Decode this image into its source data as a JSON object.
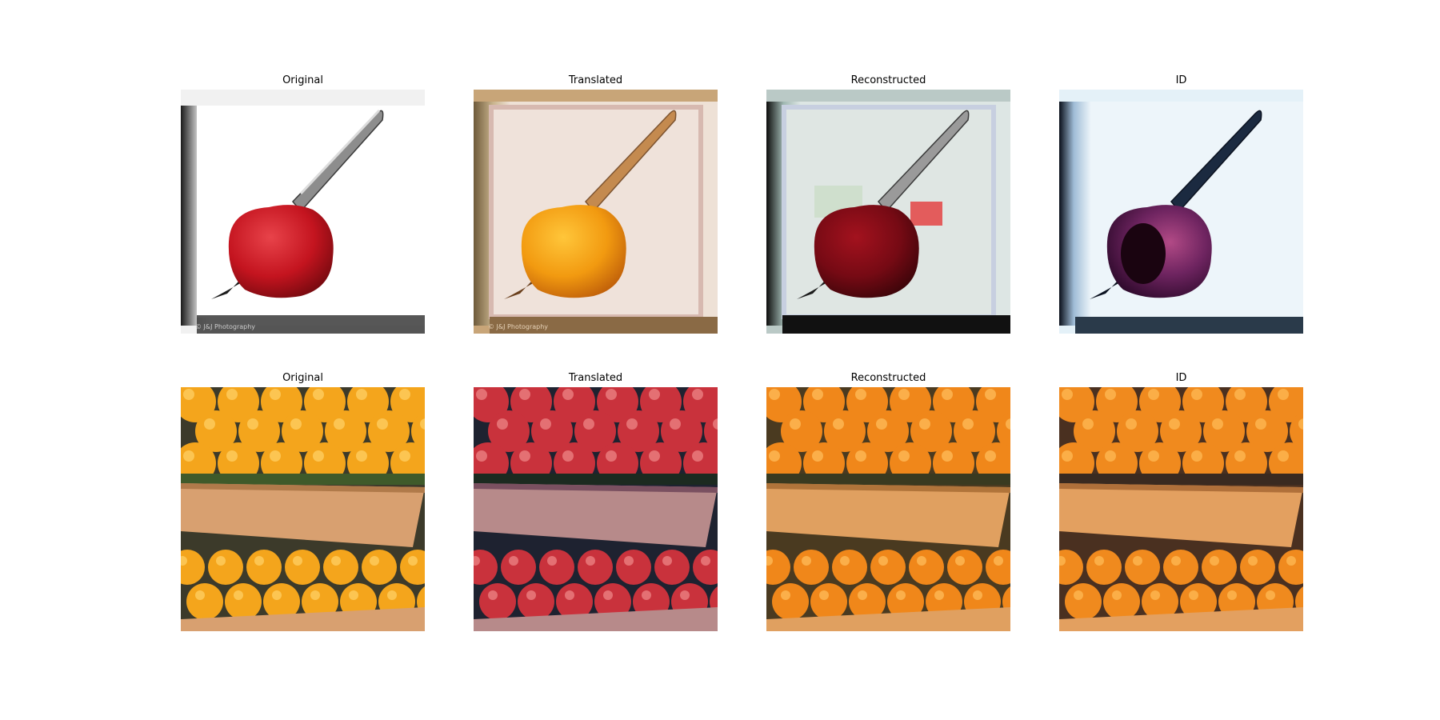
{
  "figure": {
    "rows": [
      {
        "subject": "apple with knife",
        "panels": [
          {
            "title": "Original",
            "image": "photo of red apple pierced by a silver knife on white background"
          },
          {
            "title": "Translated",
            "image": "same scene translated with the apple turned orange"
          },
          {
            "title": "Reconstructed",
            "image": "reconstruction of the apple scene, dark red apple"
          },
          {
            "title": "ID",
            "image": "identity mapping of the apple scene, purple apple on pale blue background"
          }
        ]
      },
      {
        "subject": "crates of oranges",
        "panels": [
          {
            "title": "Original",
            "image": "photo of oranges stacked in cardboard crates"
          },
          {
            "title": "Translated",
            "image": "same crates translated with oranges turned into red apples"
          },
          {
            "title": "Reconstructed",
            "image": "reconstruction of the orange crates"
          },
          {
            "title": "ID",
            "image": "identity mapping of the orange crates"
          }
        ]
      }
    ],
    "colors": {
      "background": "#ffffff",
      "title_text": "#000000"
    }
  }
}
